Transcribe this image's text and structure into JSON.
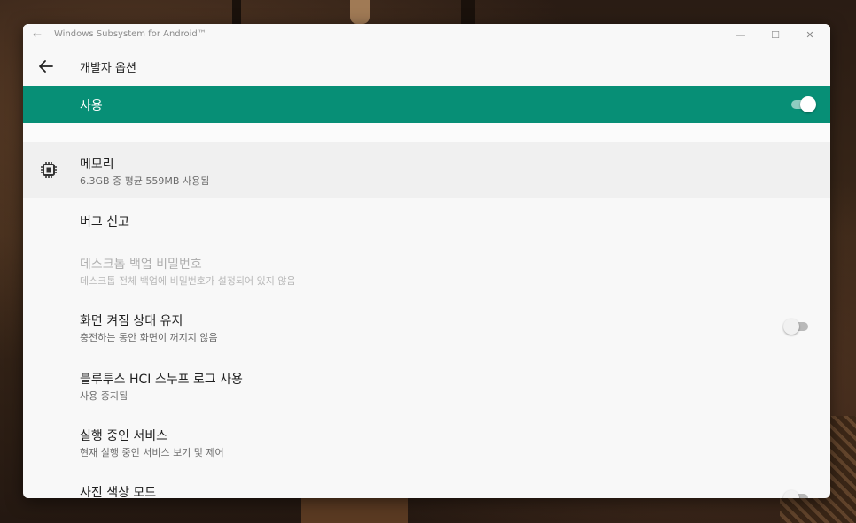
{
  "window": {
    "title": "Windows Subsystem for Android™",
    "controls": {
      "minimize": "—",
      "maximize": "☐",
      "close": "✕"
    }
  },
  "appbar": {
    "title": "개발자 옵션"
  },
  "master_switch": {
    "label": "사용",
    "on": true,
    "color": "#078f76"
  },
  "settings": [
    {
      "title": "메모리",
      "summary": "6.3GB 중 평균 559MB 사용됨",
      "icon": "memory-chip-icon"
    },
    {
      "title": "버그 신고"
    },
    {
      "title": "데스크톱 백업 비밀번호",
      "summary": "데스크톱 전체 백업에 비밀번호가 설정되어 있지 않음",
      "disabled": true
    },
    {
      "title": "화면 켜짐 상태 유지",
      "summary": "충전하는 동안 화면이 꺼지지 않음",
      "switch": false
    },
    {
      "title": "블루투스 HCI 스누프 로그 사용",
      "summary": "사용 중지됨"
    },
    {
      "title": "실행 중인 서비스",
      "summary": "현재 실행 중인 서비스 보기 및 제어"
    },
    {
      "title": "사진 색상 모드",
      "switch": false
    }
  ]
}
